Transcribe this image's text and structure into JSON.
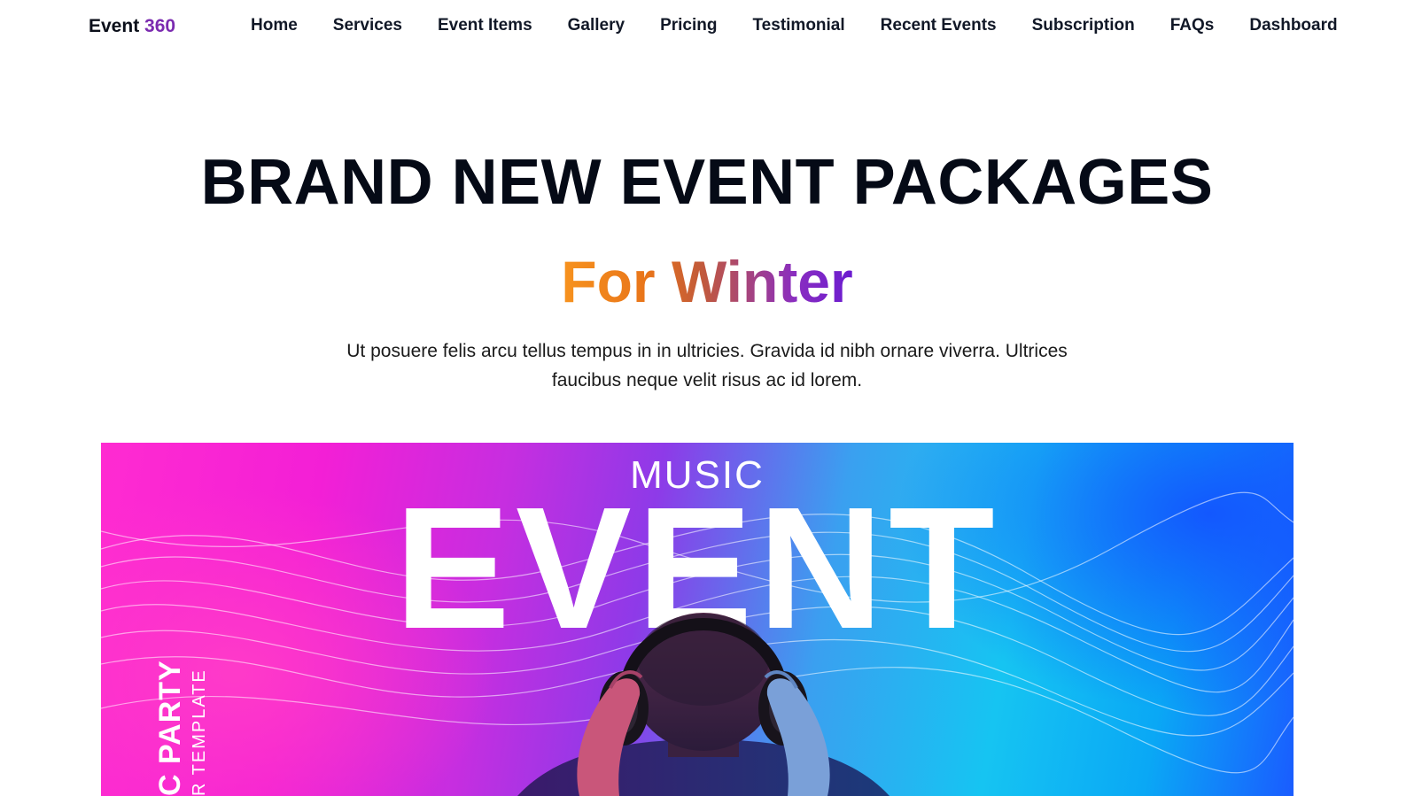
{
  "header": {
    "logo_text": "Event",
    "logo_accent": "360",
    "nav": [
      {
        "label": "Home"
      },
      {
        "label": "Services"
      },
      {
        "label": "Event Items"
      },
      {
        "label": "Gallery"
      },
      {
        "label": "Pricing"
      },
      {
        "label": "Testimonial"
      },
      {
        "label": "Recent Events"
      },
      {
        "label": "Subscription"
      },
      {
        "label": "FAQs"
      },
      {
        "label": "Dashboard"
      }
    ]
  },
  "hero": {
    "title": "BRAND NEW EVENT PACKAGES",
    "subtitle": "For Winter",
    "description": "Ut posuere felis arcu tellus tempus in in ultricies. Gravida id nibh ornare viverra. Ultrices faucibus neque velit risus ac id lorem."
  },
  "banner": {
    "top_text": "MUSIC",
    "main_text": "EVENT",
    "side_text": "C PARTY",
    "side_subtext": "R TEMPLATE"
  },
  "colors": {
    "logo_accent": "#7b2bb0",
    "subtitle_gradient_start": "#f7931e",
    "subtitle_gradient_end": "#6a1bd0",
    "banner_pink": "#ff2bd1",
    "banner_cyan": "#16c4f2",
    "banner_blue": "#1a5cff"
  }
}
